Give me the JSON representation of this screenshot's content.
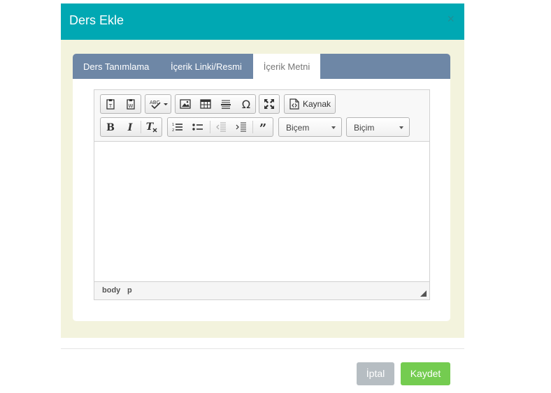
{
  "modal": {
    "title": "Ders Ekle",
    "close_glyph": "×",
    "colors": {
      "header": "#00a8b3",
      "body_bg": "#f3f3dd",
      "tabbar": "#6e87a6"
    }
  },
  "tabs": [
    {
      "label": "Ders Tanımlama",
      "active": false
    },
    {
      "label": "İçerik Linki/Resmi",
      "active": false
    },
    {
      "label": "İçerik Metni",
      "active": true
    }
  ],
  "editor": {
    "toolbar": {
      "row1": [
        "paste-text-icon",
        "paste-word-icon",
        "spellcheck-icon",
        "image-icon",
        "table-icon",
        "horizontal-line-icon",
        "special-char-icon",
        "maximize-icon",
        "source-icon"
      ],
      "source_label": "Kaynak",
      "row2": [
        "bold-icon",
        "italic-icon",
        "remove-format-icon",
        "numbered-list-icon",
        "bulleted-list-icon",
        "outdent-icon",
        "indent-icon",
        "blockquote-icon"
      ],
      "styles_combo": "Biçem",
      "format_combo": "Biçim"
    },
    "statusbar": {
      "path": [
        "body",
        "p"
      ]
    }
  },
  "footer": {
    "cancel_label": "İptal",
    "save_label": "Kaydet",
    "colors": {
      "cancel": "#b6bdc2",
      "save": "#74cc50"
    }
  }
}
